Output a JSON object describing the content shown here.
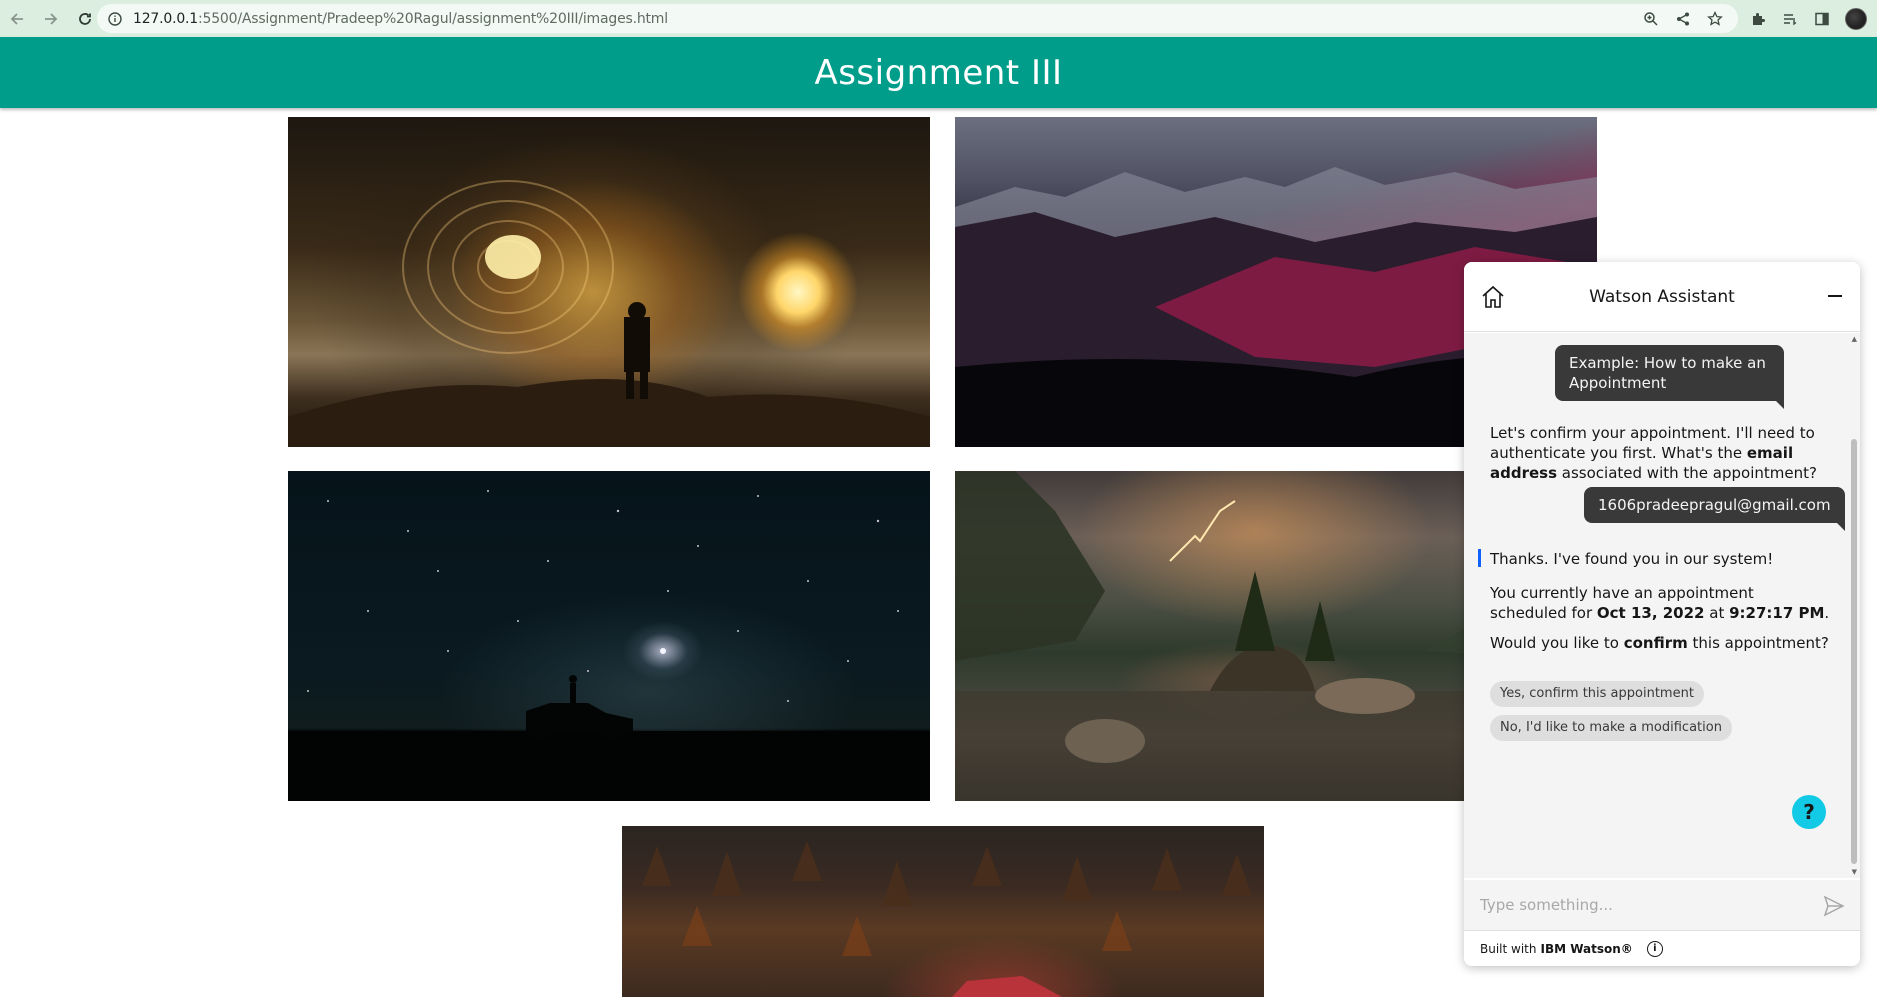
{
  "browser": {
    "url_host": "127.0.0.1",
    "url_path": ":5500/Assignment/Pradeep%20Ragul/assignment%20III/images.html",
    "back_icon": "arrow-left-icon",
    "forward_icon": "arrow-right-icon",
    "reload_icon": "reload-icon"
  },
  "header": {
    "title": "Assignment III",
    "bg_color": "#009e8a"
  },
  "gallery": {
    "images": [
      {
        "name": "person-before-glowing-portal-image"
      },
      {
        "name": "red-mountain-range-image"
      },
      {
        "name": "starry-night-car-image"
      },
      {
        "name": "lightning-lake-island-image"
      },
      {
        "name": "autumn-forest-house-image"
      }
    ]
  },
  "watson": {
    "title": "Watson Assistant",
    "messages": {
      "user1": "Example: How to make an Appointment",
      "bot1_part1": "Let's confirm your appointment. I'll need to authenticate you first. What's the ",
      "bot1_bold": "email address",
      "bot1_part2": " associated with the appointment?",
      "user2": "1606pradeepragul@gmail.com",
      "bot2": "Thanks. I've found you in our system!",
      "bot3_part1": "You currently have an appointment scheduled for ",
      "bot3_date": "Oct 13, 2022",
      "bot3_at": " at ",
      "bot3_time": "9:27:17 PM",
      "bot3_end": ".",
      "bot4_part1": "Would you like to ",
      "bot4_bold": "confirm",
      "bot4_part2": " this appointment?"
    },
    "quick_replies": [
      "Yes, confirm this appointment",
      "No, I'd like to make a modification"
    ],
    "help_label": "?",
    "input_placeholder": "Type something...",
    "footer_prefix": "Built with",
    "footer_brand": "IBM Watson®",
    "accent_color": "#12c9e6"
  }
}
